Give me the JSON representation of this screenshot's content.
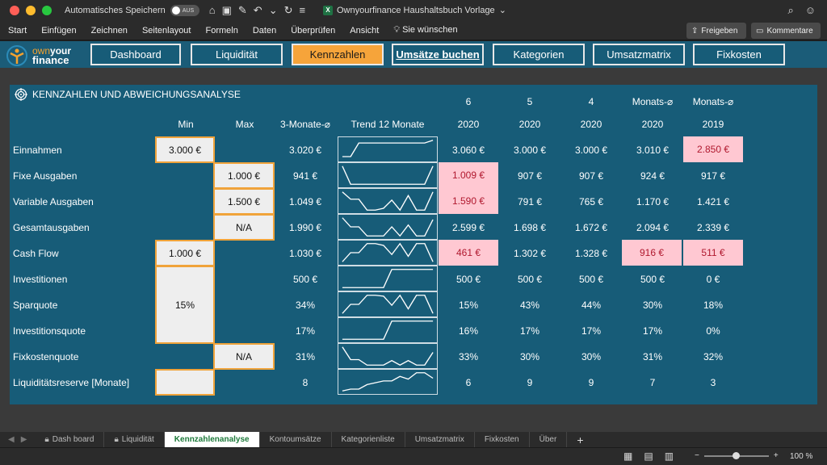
{
  "titlebar": {
    "autosave_label": "Automatisches Speichern",
    "autosave_state": "AUS",
    "document_title": "Ownyourfinance Haushaltsbuch Vorlage"
  },
  "menu": {
    "items": [
      "Start",
      "Einfügen",
      "Zeichnen",
      "Seitenlayout",
      "Formeln",
      "Daten",
      "Überprüfen",
      "Ansicht",
      "Sie wünschen"
    ],
    "share": "Freigeben",
    "comments": "Kommentare"
  },
  "logo": {
    "own": "own",
    "your": "your",
    "finance": "finance"
  },
  "nav": {
    "buttons": [
      "Dashboard",
      "Liquidität",
      "Kennzahlen",
      "Umsätze buchen",
      "Kategorien",
      "Umsatzmatrix",
      "Fixkosten"
    ],
    "active": "Kennzahlen"
  },
  "panel": {
    "title": "KENNZAHLEN UND ABWEICHUNGSANALYSE",
    "headers": {
      "min": "Min",
      "max": "Max",
      "avg3": "3-Monate-⌀",
      "trend": "Trend 12 Monate",
      "m6_top": "6",
      "m6_bot": "2020",
      "m5_top": "5",
      "m5_bot": "2020",
      "m4_top": "4",
      "m4_bot": "2020",
      "avg2020_top": "Monats-⌀",
      "avg2020_bot": "2020",
      "avg2019_top": "Monats-⌀",
      "avg2019_bot": "2019"
    },
    "rows": [
      {
        "label": "Einnahmen",
        "min": "3.000 €",
        "max": "",
        "avg3": "3.020 €",
        "m6": "3.060 €",
        "m5": "3.000 €",
        "m4": "3.000 €",
        "avg2020": "3.010 €",
        "avg2019": "2.850 €"
      },
      {
        "label": "Fixe Ausgaben",
        "min": "",
        "max": "1.000 €",
        "avg3": "941 €",
        "m6": "1.009 €",
        "m5": "907 €",
        "m4": "907 €",
        "avg2020": "924 €",
        "avg2019": "917 €"
      },
      {
        "label": "Variable Ausgaben",
        "min": "",
        "max": "1.500 €",
        "avg3": "1.049 €",
        "m6": "1.590 €",
        "m5": "791 €",
        "m4": "765 €",
        "avg2020": "1.170 €",
        "avg2019": "1.421 €"
      },
      {
        "label": "Gesamtausgaben",
        "min": "",
        "max": "N/A",
        "avg3": "1.990 €",
        "m6": "2.599 €",
        "m5": "1.698 €",
        "m4": "1.672 €",
        "avg2020": "2.094 €",
        "avg2019": "2.339 €"
      },
      {
        "label": "Cash Flow",
        "min": "1.000 €",
        "max": "",
        "avg3": "1.030 €",
        "m6": "461 €",
        "m5": "1.302 €",
        "m4": "1.328 €",
        "avg2020": "916 €",
        "avg2019": "511 €"
      },
      {
        "label": "Investitionen",
        "min": "",
        "max": "",
        "avg3": "500 €",
        "m6": "500 €",
        "m5": "500 €",
        "m4": "500 €",
        "avg2020": "500 €",
        "avg2019": "0 €"
      },
      {
        "label": "Sparquote",
        "min": "15%",
        "max": "",
        "avg3": "34%",
        "m6": "15%",
        "m5": "43%",
        "m4": "44%",
        "avg2020": "30%",
        "avg2019": "18%"
      },
      {
        "label": "Investitionsquote",
        "min": "",
        "max": "",
        "avg3": "17%",
        "m6": "16%",
        "m5": "17%",
        "m4": "17%",
        "avg2020": "17%",
        "avg2019": "0%"
      },
      {
        "label": "Fixkostenquote",
        "min": "",
        "max": "N/A",
        "avg3": "31%",
        "m6": "33%",
        "m5": "30%",
        "m4": "30%",
        "avg2020": "31%",
        "avg2019": "32%"
      },
      {
        "label": "Liquiditätsreserve [Monate]",
        "min": "",
        "max": "",
        "avg3": "8",
        "m6": "6",
        "m5": "9",
        "m4": "9",
        "avg2020": "7",
        "avg2019": "3"
      }
    ],
    "trend_series": [
      [
        10,
        10,
        85,
        85,
        85,
        85,
        85,
        85,
        85,
        85,
        85,
        100
      ],
      [
        100,
        0,
        0,
        0,
        0,
        0,
        0,
        0,
        0,
        0,
        0,
        100
      ],
      [
        100,
        60,
        60,
        0,
        0,
        10,
        55,
        0,
        80,
        0,
        0,
        100
      ],
      [
        100,
        50,
        50,
        0,
        0,
        0,
        50,
        0,
        60,
        0,
        0,
        90
      ],
      [
        0,
        50,
        50,
        100,
        100,
        90,
        40,
        100,
        30,
        100,
        100,
        0
      ],
      [
        0,
        0,
        0,
        0,
        0,
        0,
        100,
        100,
        100,
        100,
        100,
        100
      ],
      [
        0,
        50,
        50,
        100,
        100,
        95,
        45,
        100,
        25,
        100,
        100,
        0
      ],
      [
        0,
        0,
        0,
        0,
        0,
        0,
        100,
        100,
        100,
        100,
        100,
        100
      ],
      [
        100,
        30,
        30,
        0,
        0,
        0,
        25,
        0,
        25,
        0,
        0,
        70
      ],
      [
        0,
        10,
        10,
        35,
        45,
        55,
        55,
        80,
        65,
        100,
        100,
        70
      ]
    ],
    "highlight_color": "#ffc8d2",
    "target_border_color": "#f0a33a"
  },
  "sheet_tabs": {
    "tabs": [
      "Dash board",
      "Liquidität",
      "Kennzahlenanalyse",
      "Kontoumsätze",
      "Kategorienliste",
      "Umsatzmatrix",
      "Fixkosten",
      "Über"
    ],
    "active": "Kennzahlenanalyse"
  },
  "status": {
    "zoom": "100 %",
    "zoom_level": 0.5
  }
}
